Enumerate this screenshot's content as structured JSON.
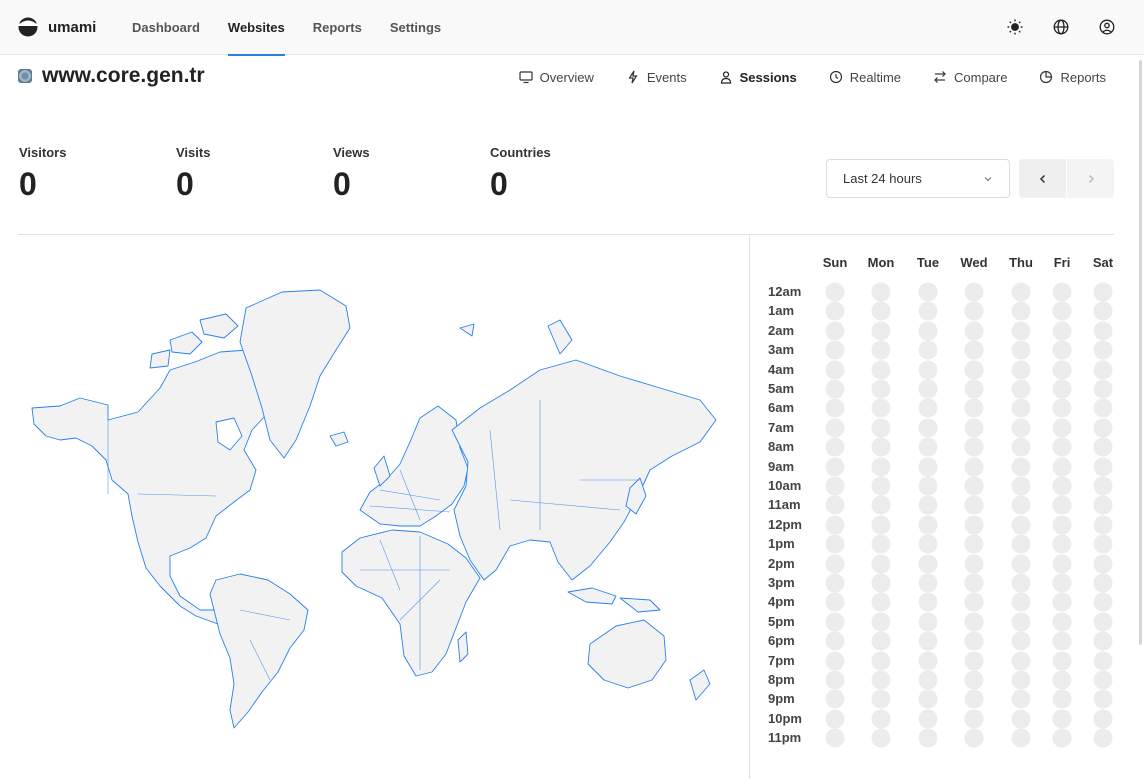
{
  "app": {
    "name": "umami"
  },
  "nav": {
    "items": [
      {
        "label": "Dashboard"
      },
      {
        "label": "Websites"
      },
      {
        "label": "Reports"
      },
      {
        "label": "Settings"
      }
    ],
    "active": "Websites",
    "icons": [
      "sun-icon",
      "globe-icon",
      "user-icon"
    ]
  },
  "website": {
    "name": "www.core.gen.tr"
  },
  "subnav": {
    "items": [
      {
        "label": "Overview",
        "icon": "monitor-icon"
      },
      {
        "label": "Events",
        "icon": "bolt-icon"
      },
      {
        "label": "Sessions",
        "icon": "user-icon"
      },
      {
        "label": "Realtime",
        "icon": "clock-icon"
      },
      {
        "label": "Compare",
        "icon": "compare-icon"
      },
      {
        "label": "Reports",
        "icon": "reports-icon"
      }
    ],
    "active": "Sessions"
  },
  "metrics": [
    {
      "label": "Visitors",
      "value": "0"
    },
    {
      "label": "Visits",
      "value": "0"
    },
    {
      "label": "Views",
      "value": "0"
    },
    {
      "label": "Countries",
      "value": "0"
    }
  ],
  "date_range": {
    "selected": "Last 24 hours"
  },
  "heatmap": {
    "days": [
      "Sun",
      "Mon",
      "Tue",
      "Wed",
      "Thu",
      "Fri",
      "Sat"
    ],
    "hours": [
      "12am",
      "1am",
      "2am",
      "3am",
      "4am",
      "5am",
      "6am",
      "7am",
      "8am",
      "9am",
      "10am",
      "11am",
      "12pm",
      "1pm",
      "2pm",
      "3pm",
      "4pm",
      "5pm",
      "6pm",
      "7pm",
      "8pm",
      "9pm",
      "10pm",
      "11pm"
    ]
  },
  "colors": {
    "accent": "#2680eb",
    "map_fill": "#f2f2f2",
    "map_stroke": "#2680eb",
    "cell_empty": "#ececec"
  }
}
